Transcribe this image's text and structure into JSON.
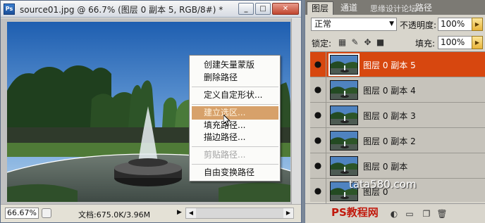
{
  "document": {
    "app_icon": "Ps",
    "title": "source01.jpg @ 66.7% (图层 0 副本 5, RGB/8#) *",
    "window_buttons": {
      "minimize": "_",
      "restore": "□",
      "close": "✕"
    },
    "zoom": "66.67%",
    "doc_info": "文档:675.0K/3.96M"
  },
  "context_menu": {
    "items": [
      {
        "label": "创建矢量蒙版",
        "state": "normal"
      },
      {
        "label": "删除路径",
        "state": "normal"
      },
      {
        "label": "定义自定形状...",
        "state": "normal"
      },
      {
        "label": "建立选区...",
        "state": "highlighted"
      },
      {
        "label": "填充路径...",
        "state": "normal"
      },
      {
        "label": "描边路径...",
        "state": "normal"
      },
      {
        "label": "剪贴路径...",
        "state": "disabled"
      },
      {
        "label": "自由变换路径",
        "state": "normal"
      }
    ]
  },
  "layers_panel": {
    "tabs": [
      "图层",
      "通道",
      "路径"
    ],
    "tab_watermark": "思缘设计论坛",
    "blend_mode": "正常",
    "opacity_label": "不透明度:",
    "opacity": "100%",
    "lock_label": "锁定:",
    "fill_label": "填充:",
    "fill": "100%",
    "layers": [
      {
        "name": "图层 0 副本 5",
        "selected": true
      },
      {
        "name": "图层 0 副本 4",
        "selected": false
      },
      {
        "name": "图层 0 副本 3",
        "selected": false
      },
      {
        "name": "图层 0 副本 2",
        "selected": false
      },
      {
        "name": "图层 0 副本",
        "selected": false
      },
      {
        "name": "图层 0",
        "selected": false
      }
    ],
    "bottom_watermark": "PS教程网",
    "site_watermark": "tata580.com"
  },
  "colors": {
    "selected_layer": "#d7470f",
    "menu_highlight": "#d7a16a"
  }
}
